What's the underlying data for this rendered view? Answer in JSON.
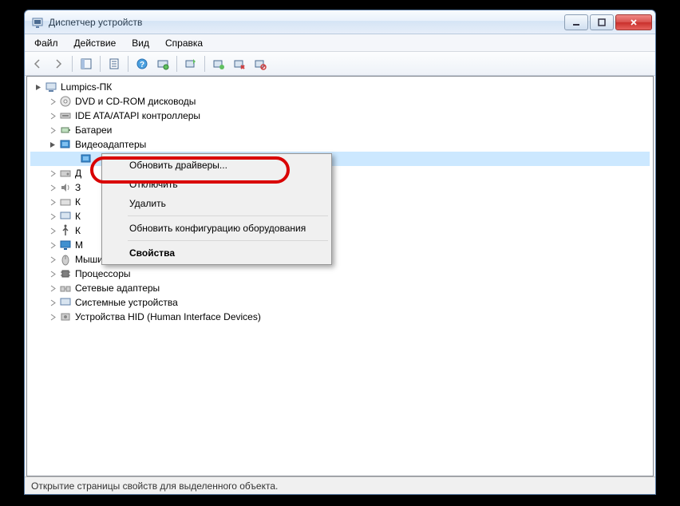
{
  "window": {
    "title": "Диспетчер устройств"
  },
  "menu": {
    "file": "Файл",
    "action": "Действие",
    "view": "Вид",
    "help": "Справка"
  },
  "tree": {
    "root": "Lumpics-ПК",
    "items": [
      "DVD и CD-ROM дисководы",
      "IDE ATA/ATAPI контроллеры",
      "Батареи",
      "Видеоадаптеры",
      "Д",
      "З",
      "К",
      "К",
      "К",
      "М",
      "Мыши и иные указывающие устройства",
      "Процессоры",
      "Сетевые адаптеры",
      "Системные устройства",
      "Устройства HID (Human Interface Devices)"
    ],
    "selected_child": ""
  },
  "context_menu": {
    "update_drivers": "Обновить драйверы...",
    "disable": "Отключить",
    "delete": "Удалить",
    "refresh_config": "Обновить конфигурацию оборудования",
    "properties": "Свойства"
  },
  "statusbar": {
    "text": "Открытие страницы свойств для выделенного объекта."
  }
}
